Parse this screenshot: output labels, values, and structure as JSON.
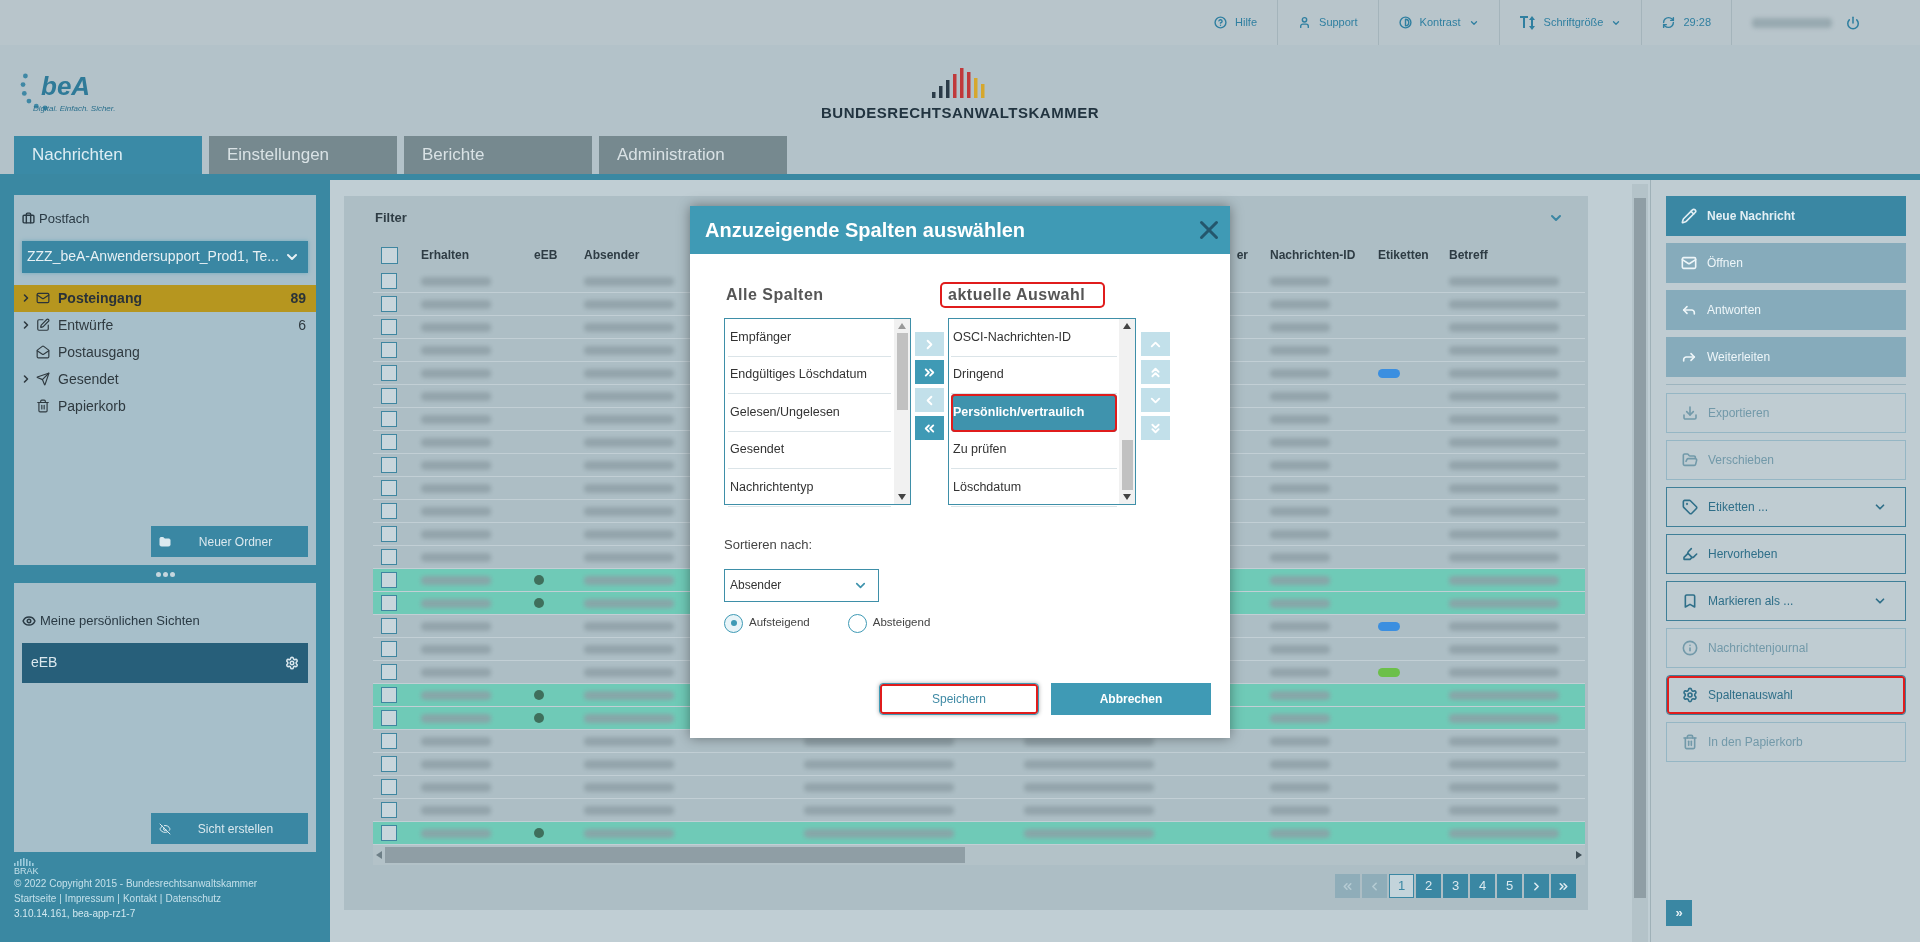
{
  "top_bar": {
    "items": [
      {
        "label": "Hilfe",
        "dropdown": false
      },
      {
        "label": "Support",
        "dropdown": false
      },
      {
        "label": "Kontrast",
        "dropdown": true
      },
      {
        "label": "Schriftgröße",
        "dropdown": true
      },
      {
        "label": "29:28",
        "dropdown": false
      }
    ]
  },
  "header": {
    "logo_text": "beA",
    "logo_tagline": "Digital. Einfach. Sicher.",
    "brand": "BUNDESRECHTSANWALTSKAMMER"
  },
  "tabs": [
    {
      "label": "Nachrichten",
      "selected": true
    },
    {
      "label": "Einstellungen",
      "selected": false
    },
    {
      "label": "Berichte",
      "selected": false
    },
    {
      "label": "Administration",
      "selected": false
    }
  ],
  "sidebar": {
    "mailbox_label": "Postfach",
    "mailbox_value": "ZZZ_beA-Anwendersupport_Prod1, Te...",
    "folders": [
      {
        "label": "Posteingang",
        "count": "89",
        "selected": true,
        "expanded": false
      },
      {
        "label": "Entwürfe",
        "count": "6",
        "selected": false,
        "expanded": false
      },
      {
        "label": "Postausgang",
        "selected": false
      },
      {
        "label": "Gesendet",
        "selected": false,
        "expanded": false
      },
      {
        "label": "Papierkorb",
        "selected": false
      }
    ],
    "new_folder_button": "Neuer Ordner",
    "views_title": "Meine persönlichen Sichten",
    "views": [
      {
        "label": "eEB",
        "selected": true
      }
    ],
    "create_view_button": "Sicht erstellen"
  },
  "footer": {
    "logo": "BRAK",
    "copyright": "© 2022 Copyright 2015 - Bundesrechtsanwaltskammer",
    "links": [
      "Startseite",
      "Impressum",
      "Kontakt",
      "Datenschutz"
    ],
    "link_separator": "|",
    "version": "3.10.14.161, bea-app-rz1-7"
  },
  "filter": {
    "title": "Filter"
  },
  "table": {
    "select_all_checked": false,
    "columns": [
      "Erhalten",
      "eEB",
      "Absender",
      "er",
      "Nachrichten-ID",
      "Etiketten",
      "Betreff"
    ],
    "rows": [
      {
        "highlighted": false,
        "eeb": false
      },
      {
        "highlighted": false,
        "eeb": false
      },
      {
        "highlighted": false,
        "eeb": false
      },
      {
        "highlighted": false,
        "eeb": false
      },
      {
        "highlighted": false,
        "eeb": false,
        "tag": {
          "color": "#3b8fe0"
        }
      },
      {
        "highlighted": false,
        "eeb": false
      },
      {
        "highlighted": false,
        "eeb": false
      },
      {
        "highlighted": false,
        "eeb": false
      },
      {
        "highlighted": false,
        "eeb": false
      },
      {
        "highlighted": false,
        "eeb": false
      },
      {
        "highlighted": false,
        "eeb": false
      },
      {
        "highlighted": false,
        "eeb": false
      },
      {
        "highlighted": false,
        "eeb": false
      },
      {
        "highlighted": true,
        "eeb": true
      },
      {
        "highlighted": true,
        "eeb": true
      },
      {
        "highlighted": false,
        "eeb": false,
        "tag": {
          "color": "#3b8fe0"
        }
      },
      {
        "highlighted": false,
        "eeb": false
      },
      {
        "highlighted": false,
        "eeb": false,
        "tag": {
          "color": "#6cc04a"
        }
      },
      {
        "highlighted": true,
        "eeb": true
      },
      {
        "highlighted": true,
        "eeb": true
      },
      {
        "highlighted": false,
        "eeb": false
      },
      {
        "highlighted": false,
        "eeb": false
      },
      {
        "highlighted": false,
        "eeb": false
      },
      {
        "highlighted": false,
        "eeb": false
      },
      {
        "highlighted": true,
        "eeb": true
      }
    ]
  },
  "pagination": {
    "nav_before": [
      {
        "disabled": true
      },
      {
        "disabled": true
      }
    ],
    "pages": [
      {
        "label": "1",
        "selected": true
      },
      {
        "label": "2",
        "selected": false
      },
      {
        "label": "3",
        "selected": false
      },
      {
        "label": "4",
        "selected": false
      },
      {
        "label": "5",
        "selected": false
      }
    ],
    "nav_after": [
      {
        "disabled": false
      },
      {
        "disabled": false
      }
    ]
  },
  "actions": [
    {
      "kind": "filled",
      "label": "Neue Nachricht",
      "disabled": false,
      "dropdown": false,
      "annotated": false
    },
    {
      "kind": "filled",
      "label": "Öffnen",
      "disabled": true,
      "dropdown": false,
      "annotated": false
    },
    {
      "kind": "filled",
      "label": "Antworten",
      "disabled": true,
      "dropdown": false,
      "annotated": false
    },
    {
      "kind": "filled",
      "label": "Weiterleiten",
      "disabled": true,
      "dropdown": false,
      "annotated": false
    },
    {
      "kind": "outline",
      "label": "Exportieren",
      "disabled": true,
      "dropdown": false,
      "annotated": false
    },
    {
      "kind": "outline",
      "label": "Verschieben",
      "disabled": true,
      "dropdown": false,
      "annotated": false
    },
    {
      "kind": "outline",
      "label": "Etiketten ...",
      "disabled": false,
      "dropdown": true,
      "annotated": false
    },
    {
      "kind": "outline",
      "label": "Hervorheben",
      "disabled": false,
      "dropdown": false,
      "annotated": false
    },
    {
      "kind": "outline",
      "label": "Markieren als ...",
      "disabled": false,
      "dropdown": true,
      "annotated": false
    },
    {
      "kind": "outline",
      "label": "Nachrichtenjournal",
      "disabled": true,
      "dropdown": false,
      "annotated": false
    },
    {
      "kind": "outline",
      "label": "Spaltenauswahl",
      "disabled": false,
      "dropdown": false,
      "annotated": true
    },
    {
      "kind": "outline",
      "label": "In den Papierkorb",
      "disabled": true,
      "dropdown": false,
      "annotated": false
    }
  ],
  "collapse_button": "»",
  "modal": {
    "title": "Anzuzeigende Spalten auswählen",
    "all_columns_title": "Alle Spalten",
    "current_title": "aktuelle Auswahl",
    "current_title_annotated": true,
    "all_columns": [
      {
        "label": "Empfänger"
      },
      {
        "label": "Endgültiges Löschdatum"
      },
      {
        "label": "Gelesen/Ungelesen"
      },
      {
        "label": "Gesendet"
      },
      {
        "label": "Nachrichtentyp"
      }
    ],
    "current": [
      {
        "label": "OSCI-Nachrichten-ID",
        "selected": false,
        "annotated": false
      },
      {
        "label": "Dringend",
        "selected": false,
        "annotated": false
      },
      {
        "label": "Persönlich/vertraulich",
        "selected": true,
        "annotated": true
      },
      {
        "label": "Zu prüfen",
        "selected": false,
        "annotated": false
      },
      {
        "label": "Löschdatum",
        "selected": false,
        "annotated": false
      }
    ],
    "transfer_buttons": [
      {
        "disabled": true
      },
      {
        "disabled": false
      },
      {
        "disabled": true
      },
      {
        "disabled": false
      }
    ],
    "order_buttons": [
      {
        "disabled": true
      },
      {
        "disabled": true
      },
      {
        "disabled": true
      },
      {
        "disabled": true
      }
    ],
    "sort_label": "Sortieren nach:",
    "sort_value": "Absender",
    "order_options": [
      {
        "label": "Aufsteigend",
        "selected": true
      },
      {
        "label": "Absteigend",
        "selected": false
      }
    ],
    "buttons": [
      {
        "kind": "secondary",
        "label": "Speichern",
        "annotated": true
      },
      {
        "kind": "primary",
        "label": "Abbrechen",
        "annotated": false
      }
    ]
  }
}
